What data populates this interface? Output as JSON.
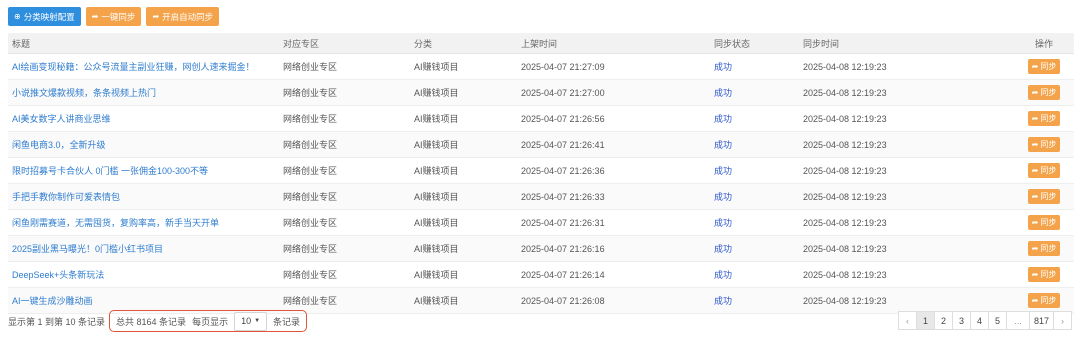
{
  "toolbar": {
    "mapping_label": "分类映射配置",
    "sync_label": "一键同步",
    "auto_sync_label": "开启自动同步"
  },
  "table": {
    "headers": {
      "title": "标题",
      "zone": "对应专区",
      "category": "分类",
      "list_time": "上架时间",
      "status": "同步状态",
      "sync_time": "同步时间",
      "actions": "操作"
    },
    "action_label": "同步",
    "rows": [
      {
        "title": "AI绘画变现秘籍：公众号流量主副业狂赚，网创人速来掘金！",
        "zone": "网络创业专区",
        "category": "AI赚钱项目",
        "list_time": "2025-04-07 21:27:09",
        "status": "成功",
        "sync_time": "2025-04-08 12:19:23"
      },
      {
        "title": "小说推文爆款视频，条条视频上热门",
        "zone": "网络创业专区",
        "category": "AI赚钱项目",
        "list_time": "2025-04-07 21:27:00",
        "status": "成功",
        "sync_time": "2025-04-08 12:19:23"
      },
      {
        "title": "AI美女数字人讲商业思维",
        "zone": "网络创业专区",
        "category": "AI赚钱项目",
        "list_time": "2025-04-07 21:26:56",
        "status": "成功",
        "sync_time": "2025-04-08 12:19:23"
      },
      {
        "title": "闲鱼电商3.0，全新升级",
        "zone": "网络创业专区",
        "category": "AI赚钱项目",
        "list_time": "2025-04-07 21:26:41",
        "status": "成功",
        "sync_time": "2025-04-08 12:19:23"
      },
      {
        "title": "限时招募号卡合伙人 0门槛 一张佣金100-300不等",
        "zone": "网络创业专区",
        "category": "AI赚钱项目",
        "list_time": "2025-04-07 21:26:36",
        "status": "成功",
        "sync_time": "2025-04-08 12:19:23"
      },
      {
        "title": "手把手教你制作可爱表情包",
        "zone": "网络创业专区",
        "category": "AI赚钱项目",
        "list_time": "2025-04-07 21:26:33",
        "status": "成功",
        "sync_time": "2025-04-08 12:19:23"
      },
      {
        "title": "闲鱼刚需赛道，无需囤货，复购率高，新手当天开单",
        "zone": "网络创业专区",
        "category": "AI赚钱项目",
        "list_time": "2025-04-07 21:26:31",
        "status": "成功",
        "sync_time": "2025-04-08 12:19:23"
      },
      {
        "title": "2025副业黑马曝光！0门槛小红书项目",
        "zone": "网络创业专区",
        "category": "AI赚钱项目",
        "list_time": "2025-04-07 21:26:16",
        "status": "成功",
        "sync_time": "2025-04-08 12:19:23"
      },
      {
        "title": "DeepSeek+头条新玩法",
        "zone": "网络创业专区",
        "category": "AI赚钱项目",
        "list_time": "2025-04-07 21:26:14",
        "status": "成功",
        "sync_time": "2025-04-08 12:19:23"
      },
      {
        "title": "AI一键生成沙雕动画",
        "zone": "网络创业专区",
        "category": "AI赚钱项目",
        "list_time": "2025-04-07 21:26:08",
        "status": "成功",
        "sync_time": "2025-04-08 12:19:23"
      }
    ]
  },
  "footer": {
    "range_text": "显示第 1 到第 10 条记录",
    "total_text": "总共 8164 条记录",
    "per_page_label": "每页显示",
    "per_page_value": "10",
    "records_suffix": "条记录"
  },
  "pagination": {
    "prev": "‹",
    "pages": [
      "1",
      "2",
      "3",
      "4",
      "5"
    ],
    "ellipsis": "...",
    "last": "817",
    "next": "›",
    "active": "1"
  },
  "icons": {
    "mapping": "plus-circle-icon",
    "share": "share-arrow-icon",
    "dropdown": "caret-down-icon"
  },
  "colors": {
    "primary": "#2f8fdf",
    "warning": "#f5a34b",
    "link": "#2f7ccf",
    "success_text": "#2a55cc",
    "highlight_border": "#e2553a"
  }
}
